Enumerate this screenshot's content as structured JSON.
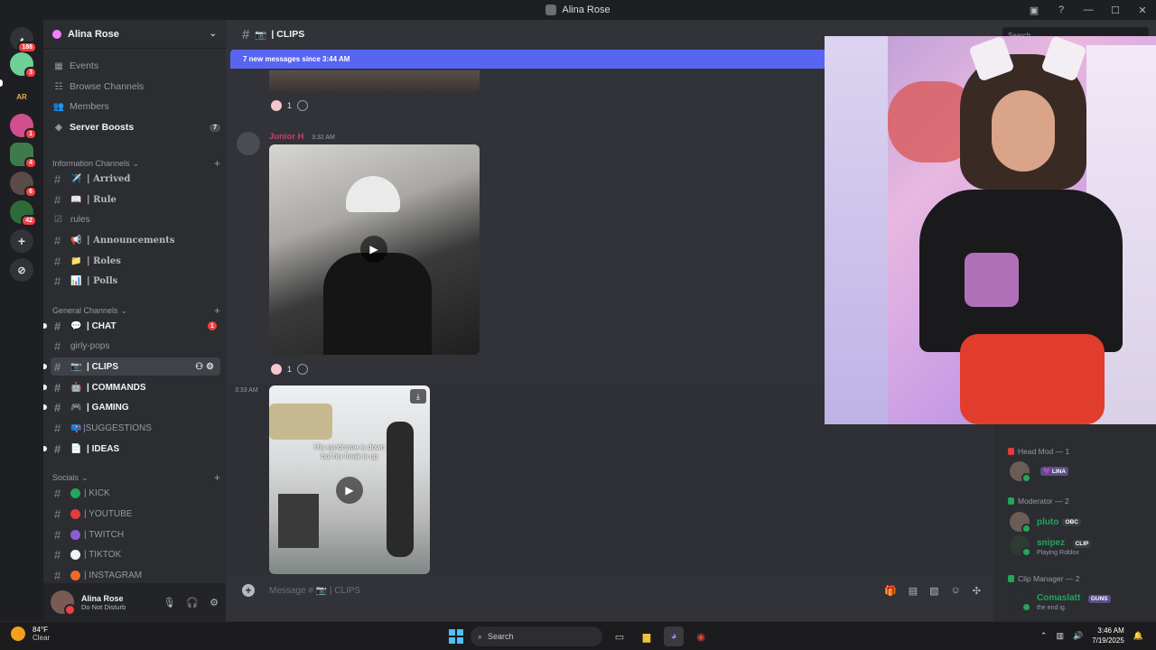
{
  "window": {
    "title": "Alina Rose",
    "search_placeholder": "Search"
  },
  "rail": {
    "home_badge": "188",
    "servers": [
      {
        "label": "",
        "color": "#6fcf97",
        "badge": "3"
      },
      {
        "label": "AR",
        "color": "#1e1f22",
        "badge": ""
      },
      {
        "label": "",
        "color": "#d04f8f",
        "badge": "1"
      },
      {
        "label": "",
        "color": "#3f7a4d",
        "badge": "4"
      },
      {
        "label": "",
        "color": "#5a4a48",
        "badge": "6"
      },
      {
        "label": "",
        "color": "#2f6b3a",
        "badge": "42"
      }
    ]
  },
  "sidebar": {
    "server_name": "Alina Rose",
    "nav": [
      {
        "label": "Events",
        "icon": "calendar-icon"
      },
      {
        "label": "Browse Channels",
        "icon": "browse-icon"
      },
      {
        "label": "Members",
        "icon": "members-icon"
      },
      {
        "label": "Server Boosts",
        "icon": "boost-icon",
        "count": "7"
      }
    ],
    "categories": {
      "info": "Information Channels",
      "general": "General Channels",
      "socials": "Socials"
    },
    "info_channels": [
      "| Arrived",
      "| Rule",
      "rules",
      "| Announcements",
      "| Roles",
      "| Polls"
    ],
    "general_channels": [
      "| CHAT",
      "girly-pops",
      "| CLIPS",
      "| COMMANDS",
      "| GAMING",
      "|SUGGESTIONS",
      "| IDEAS"
    ],
    "chat_badge": "1",
    "social_channels": [
      "| KICK",
      "| YOUTUBE",
      "| TWITCH",
      "| TIKTOK",
      "| INSTAGRAM"
    ],
    "social_colors": [
      "#23a55a",
      "#e23c3c",
      "#8e5bd6",
      "#f2f3f5",
      "#f06a2b"
    ]
  },
  "user": {
    "name": "Alina Rose",
    "status": "Do Not Disturb"
  },
  "chat": {
    "channel_name": "| CLIPS",
    "new_messages": "7 new messages since 3:44 AM",
    "reaction_count_1": "1",
    "reaction_count_2": "1",
    "author": "Junior H",
    "author_time": "3:32 AM",
    "side_time": "3:33 AM",
    "video_caption_line1": "His syndrome is down",
    "video_caption_line2": "but his freak is up",
    "composer_placeholder": "Message # 📷 | CLIPS"
  },
  "members": {
    "roles": [
      {
        "name": "Head Mod — 1",
        "color": "#e23c3c"
      },
      {
        "name": "Moderator — 2",
        "color": "#23a55a"
      },
      {
        "name": "Clip Manager — 2",
        "color": "#23a55a"
      }
    ],
    "people": [
      {
        "name": "",
        "tag": "💜 LINA",
        "sub": "",
        "color": "#f2f3f5"
      },
      {
        "name": "pluto",
        "tag": "OBC",
        "sub": "",
        "color": "#23a55a"
      },
      {
        "name": "snipez",
        "tag": "CLIP",
        "sub": "Playing Roblox",
        "color": "#23a55a"
      },
      {
        "name": "Comaslatt",
        "tag": "GUNS",
        "sub": "the end ig.",
        "color": "#23a55a"
      }
    ]
  },
  "taskbar": {
    "temp": "84°F",
    "weather": "Clear",
    "search": "Search",
    "time": "3:46 AM",
    "date": "7/19/2025"
  }
}
